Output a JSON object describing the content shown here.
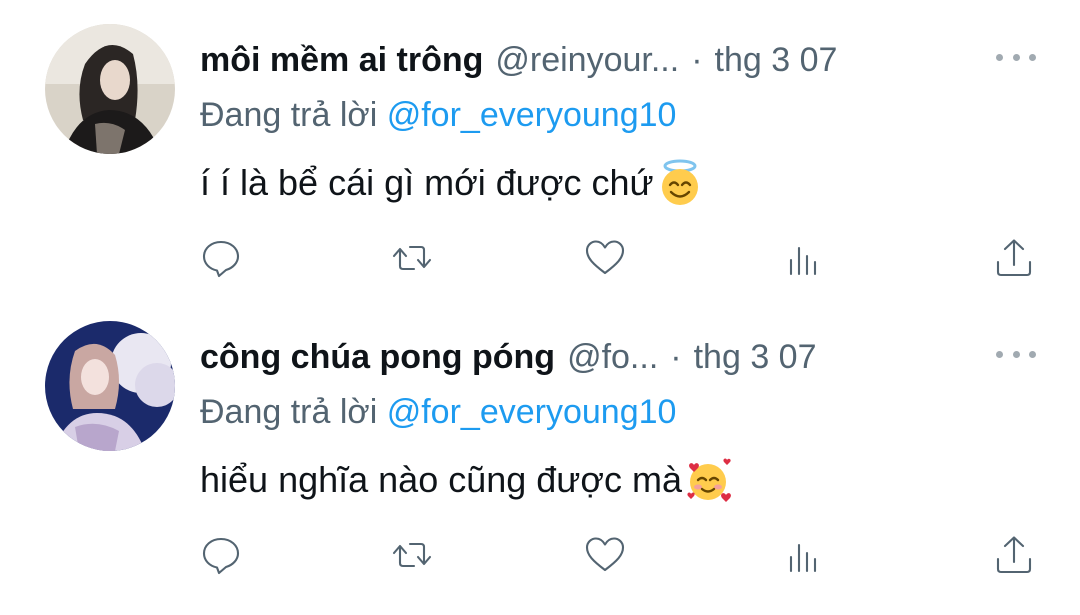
{
  "tweets": [
    {
      "display_name": "môi mềm ai trông",
      "handle": "@reinyour...",
      "separator": "·",
      "date": "thg 3 07",
      "reply_prefix": "Đang trả lời",
      "reply_to": "@for_everyoung10",
      "text": "í í là bể cái gì mới được chứ",
      "emoji": "smiling-face-with-halo",
      "avatar_colors": [
        "#d9d3c8",
        "#2b2624",
        "#7d746c"
      ]
    },
    {
      "display_name": "công chúa pong póng",
      "handle": "@fo...",
      "separator": "·",
      "date": "thg 3 07",
      "reply_prefix": "Đang trả lời",
      "reply_to": "@for_everyoung10",
      "text": "hiểu nghĩa nào cũng được mà",
      "emoji": "smiling-face-with-hearts",
      "avatar_colors": [
        "#1b2a6b",
        "#e9e7f2",
        "#c9a7a2"
      ]
    }
  ],
  "action_icons": [
    "reply-icon",
    "retweet-icon",
    "like-icon",
    "views-icon",
    "share-icon"
  ],
  "colors": {
    "text": "#0f1419",
    "muted": "#536471",
    "link": "#1d9bf0"
  }
}
